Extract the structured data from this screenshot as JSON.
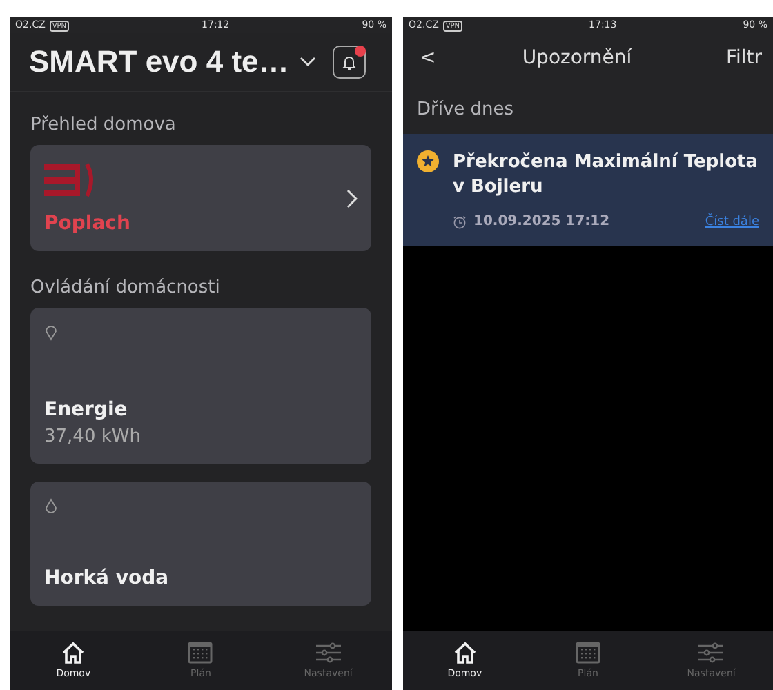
{
  "screens": [
    {
      "status_bar": {
        "carrier": "O2.CZ",
        "vpn": "VPN",
        "time": "17:12",
        "battery": "90 %"
      },
      "header": {
        "kind": "home",
        "title": "SMART evo 4 te…",
        "unread": true
      },
      "sections": [
        {
          "title": "Přehled domova",
          "cards": [
            {
              "kind": "alarm",
              "label": "Poplach"
            }
          ]
        },
        {
          "title": "Ovládání domácnosti",
          "cards": [
            {
              "kind": "energy",
              "label": "Energie",
              "value": "37,40 kWh"
            },
            {
              "kind": "water",
              "label": "Horká voda"
            }
          ]
        }
      ],
      "tabs": [
        {
          "label": "Domov",
          "selected": true
        },
        {
          "label": "Plán",
          "selected": false
        },
        {
          "label": "Nastavení",
          "selected": false
        }
      ]
    },
    {
      "status_bar": {
        "carrier": "O2.CZ",
        "vpn": "VPN",
        "time": "17:13",
        "battery": "90 %"
      },
      "header": {
        "kind": "detail",
        "back": "<",
        "title": "Upozornění",
        "action": "Filtr"
      },
      "group": "Dříve dnes",
      "notifications": [
        {
          "title": "Překročena Maximální Teplota v Bojleru",
          "time": "10.09.2025 17:12",
          "link": "Číst dále",
          "unread": true
        }
      ],
      "tabs": [
        {
          "label": "Domov",
          "selected": true
        },
        {
          "label": "Plán",
          "selected": false
        },
        {
          "label": "Nastavení",
          "selected": false
        }
      ]
    }
  ]
}
